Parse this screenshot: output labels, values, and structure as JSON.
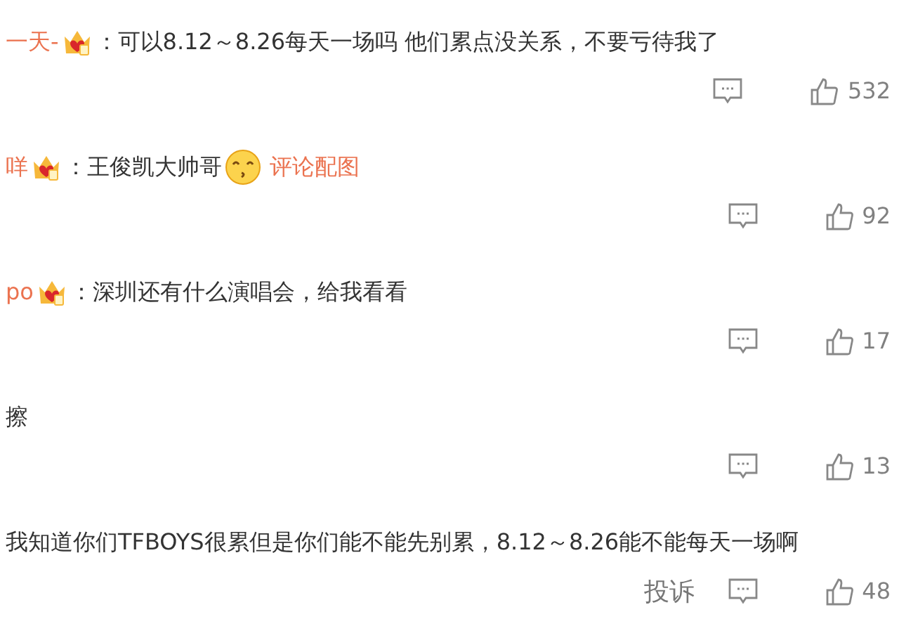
{
  "comments": [
    {
      "user": "一天-",
      "parts": [
        {
          "kind": "badge"
        },
        {
          "kind": "text",
          "text": "：可以8.12～8.26每天一场吗 他们累点没关系，不要亏待我了"
        }
      ],
      "likes": "532"
    },
    {
      "user": "咩",
      "parts": [
        {
          "kind": "badge"
        },
        {
          "kind": "text",
          "text": "：王俊凯大帅哥"
        },
        {
          "kind": "emoji"
        },
        {
          "kind": "link",
          "text": "评论配图"
        }
      ],
      "likes": "92"
    },
    {
      "user": "po",
      "parts": [
        {
          "kind": "badge"
        },
        {
          "kind": "text",
          "text": "：深圳还有什么演唱会，给我看看"
        }
      ],
      "likes": "17"
    },
    {
      "parts": [
        {
          "kind": "text",
          "text": "擦"
        }
      ],
      "likes": "13"
    },
    {
      "parts": [
        {
          "kind": "text",
          "text": "我知道你们TFBOYS很累但是你们能不能先别累，8.12～8.26能不能每天一场啊"
        }
      ],
      "likes": "48",
      "report": "投诉"
    }
  ]
}
